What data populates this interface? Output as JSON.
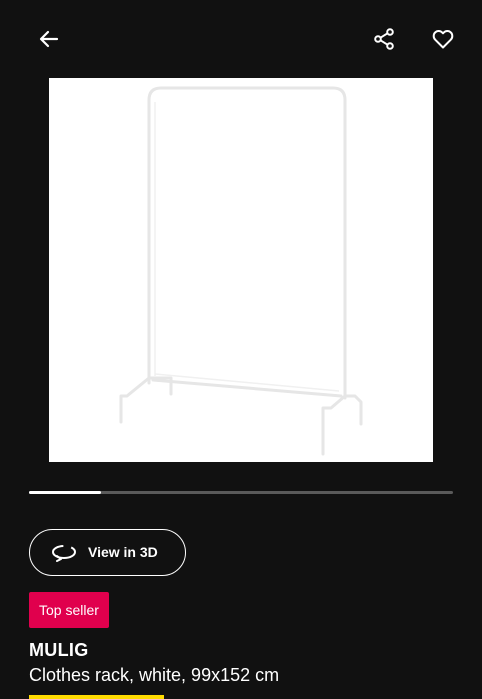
{
  "header": {
    "back_icon": "arrow-left-icon",
    "share_icon": "share-icon",
    "favourite_icon": "heart-outline-icon"
  },
  "gallery": {
    "image_subject": "clothes-rack-product-photo",
    "current_slide_fraction": 0.17
  },
  "actions": {
    "view_3d_label": "View in 3D",
    "view_3d_icon": "rotate-3d-icon"
  },
  "product": {
    "badge": "Top seller",
    "name": "MULIG",
    "description": "Clothes rack, white, 99x152 cm"
  },
  "colors": {
    "background": "#111111",
    "badge": "#e0004d",
    "price_tag": "#ffdb00",
    "carousel_track": "#5a5a5a",
    "carousel_active": "#ffffff"
  }
}
